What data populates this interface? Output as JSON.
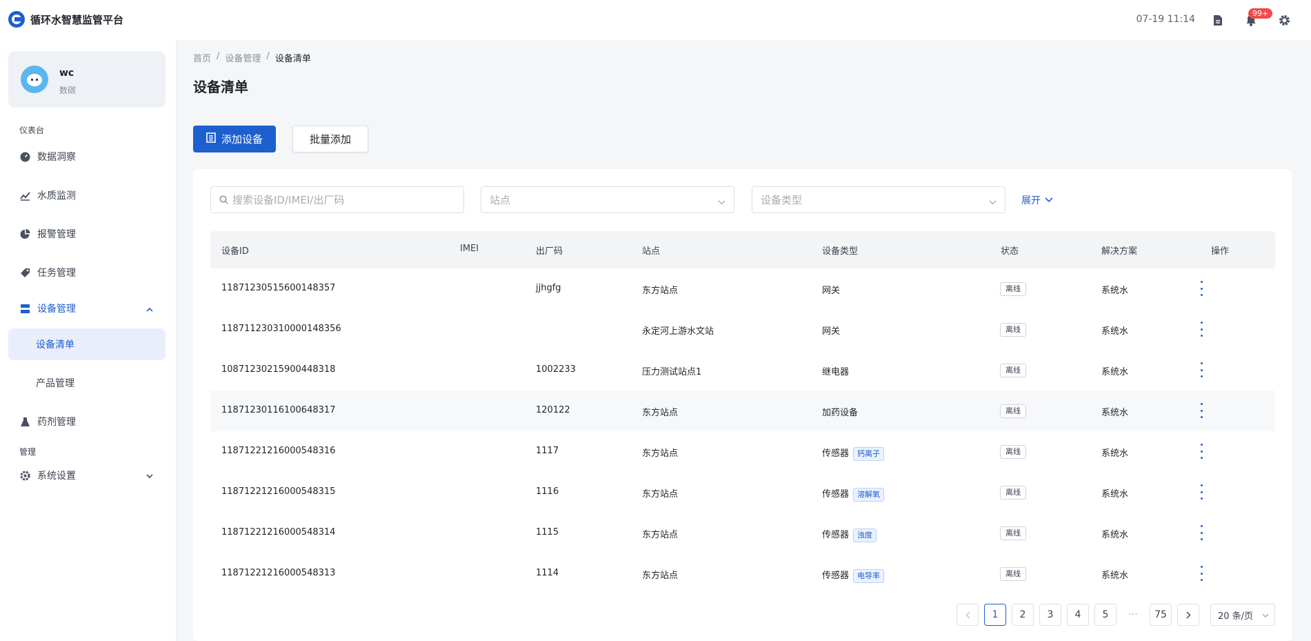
{
  "app": {
    "title": "循环水智慧监管平台"
  },
  "header": {
    "time": "07-19 11:14",
    "notification_badge": "99+"
  },
  "user": {
    "name": "wc",
    "role": "数碳"
  },
  "sidebar": {
    "section_dashboard": "仪表台",
    "section_manage": "管理",
    "items": [
      {
        "label": "数据洞察",
        "icon": "dashboard-icon"
      },
      {
        "label": "水质监测",
        "icon": "line-chart-icon"
      },
      {
        "label": "报警管理",
        "icon": "pie-chart-icon"
      },
      {
        "label": "任务管理",
        "icon": "tag-icon"
      },
      {
        "label": "设备管理",
        "icon": "server-icon"
      },
      {
        "label": "设备清单"
      },
      {
        "label": "产品管理"
      },
      {
        "label": "药剂管理",
        "icon": "flask-icon"
      },
      {
        "label": "系统设置",
        "icon": "gear-icon"
      }
    ]
  },
  "breadcrumb": [
    "首页",
    "/",
    "设备管理",
    "/",
    "设备清单"
  ],
  "page_title": "设备清单",
  "toolbar": {
    "add_label": "添加设备",
    "batch_label": "批量添加"
  },
  "filters": {
    "search_placeholder": "搜索设备ID/IMEI/出厂码",
    "site_placeholder": "站点",
    "type_placeholder": "设备类型",
    "expand_label": "展开"
  },
  "table": {
    "columns": [
      "设备ID",
      "IMEI",
      "出厂码",
      "站点",
      "设备类型",
      "状态",
      "解决方案",
      "操作"
    ],
    "rows": [
      {
        "id": "11871230515600148357",
        "imei": "",
        "code": "jjhgfg",
        "site": "东方站点",
        "type": "网关",
        "sub": "",
        "status": "离线",
        "solution": "系统水"
      },
      {
        "id": "11871123031000014835​6",
        "imei": "",
        "code": "",
        "site": "永定河上游水文站",
        "type": "网关",
        "sub": "",
        "status": "离线",
        "solution": "系统水"
      },
      {
        "id": "10871230215900448318",
        "imei": "",
        "code": "1002233",
        "site": "压力测试站点1",
        "type": "继电器",
        "sub": "",
        "status": "离线",
        "solution": "系统水"
      },
      {
        "id": "11871230116100648317",
        "imei": "",
        "code": "120122",
        "site": "东方站点",
        "type": "加药设备",
        "sub": "",
        "status": "离线",
        "solution": "系统水"
      },
      {
        "id": "11871221216000548316",
        "imei": "",
        "code": "1117",
        "site": "东方站点",
        "type": "传感器",
        "sub": "钙离子",
        "status": "离线",
        "solution": "系统水"
      },
      {
        "id": "11871221216000548315",
        "imei": "",
        "code": "1116",
        "site": "东方站点",
        "type": "传感器",
        "sub": "溶解氧",
        "status": "离线",
        "solution": "系统水"
      },
      {
        "id": "11871221216000548314",
        "imei": "",
        "code": "1115",
        "site": "东方站点",
        "type": "传感器",
        "sub": "浊度",
        "status": "离线",
        "solution": "系统水"
      },
      {
        "id": "11871221216000548313",
        "imei": "",
        "code": "1114",
        "site": "东方站点",
        "type": "传感器",
        "sub": "电导率",
        "status": "离线",
        "solution": "系统水"
      }
    ]
  },
  "pagination": {
    "pages": [
      "1",
      "2",
      "3",
      "4",
      "5",
      "···",
      "75"
    ],
    "current": "1",
    "page_size": "20 条/页"
  },
  "colors": {
    "primary": "#1d5fcf",
    "badge": "#f04b4b"
  }
}
